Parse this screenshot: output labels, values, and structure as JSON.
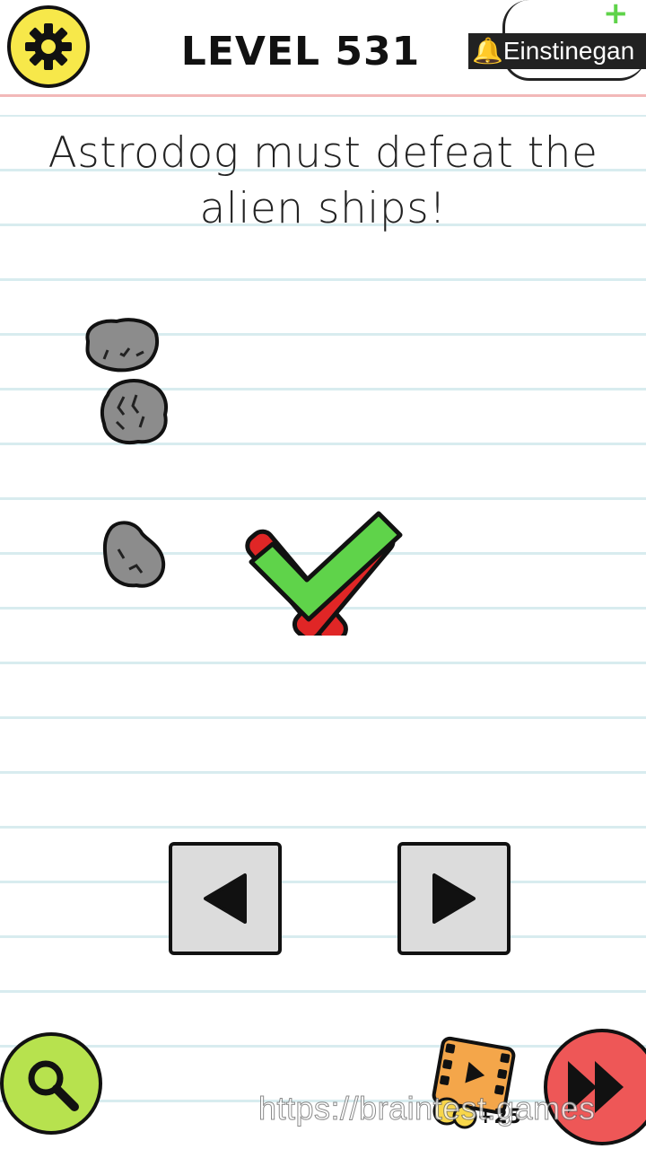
{
  "header": {
    "level_title": "LEVEL 531",
    "promo_text": "Einstinegan",
    "settings_icon": "gear-icon"
  },
  "puzzle": {
    "question": "Astrodog must defeat the alien ships!",
    "answer_mark": "check-over-cross-icon"
  },
  "controls": {
    "left_icon": "triangle-left-icon",
    "right_icon": "triangle-right-icon"
  },
  "footer": {
    "hint_icon": "magnifier-icon",
    "video_reward": "+25",
    "skip_icon": "skip-forward-icon"
  },
  "watermark": "https://braintest.games",
  "colors": {
    "settings_bg": "#f7e84a",
    "hint_bg": "#b7e24e",
    "skip_bg": "#ee5757",
    "check": "#5fd34a",
    "cross": "#e02626",
    "rock": "#8c8c8c",
    "line": "#d8ecef",
    "header_border": "#f2b8b8"
  }
}
